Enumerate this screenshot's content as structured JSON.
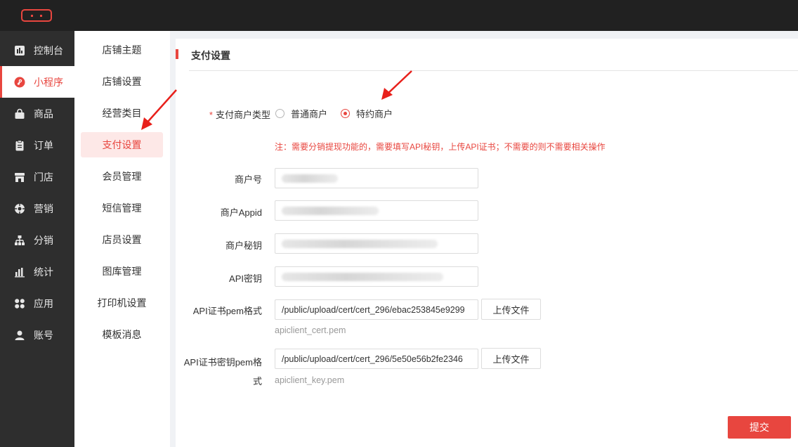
{
  "sidebar": {
    "items": [
      {
        "label": "控制台",
        "icon": "dashboard-icon"
      },
      {
        "label": "小程序",
        "icon": "mini-program-icon"
      },
      {
        "label": "商品",
        "icon": "shopping-bag-icon"
      },
      {
        "label": "订单",
        "icon": "clipboard-icon"
      },
      {
        "label": "门店",
        "icon": "store-icon"
      },
      {
        "label": "营销",
        "icon": "marketing-icon"
      },
      {
        "label": "分销",
        "icon": "hierarchy-icon"
      },
      {
        "label": "统计",
        "icon": "bar-chart-icon"
      },
      {
        "label": "应用",
        "icon": "apps-grid-icon"
      },
      {
        "label": "账号",
        "icon": "user-icon"
      }
    ],
    "active_index": 1
  },
  "subnav": {
    "items": [
      "店铺主题",
      "店铺设置",
      "经营类目",
      "支付设置",
      "会员管理",
      "短信管理",
      "店员设置",
      "图库管理",
      "打印机设置",
      "模板消息"
    ],
    "active_index": 3
  },
  "form": {
    "section_title": "支付设置",
    "merchant_type": {
      "required_mark": "*",
      "label": "支付商户类型",
      "options": [
        "普通商户",
        "特约商户"
      ],
      "selected": "特约商户"
    },
    "note": "注：需要分销提现功能的，需要填写API秘钥，上传API证书；不需要的则不需要相关操作",
    "merchant_id_label": "商户号",
    "merchant_appid_label": "商户Appid",
    "merchant_secret_label": "商户秘钥",
    "api_key_label": "API密钥",
    "cert_pem_label": "API证书pem格式",
    "cert_pem_value": "/public/upload/cert/cert_296/ebac253845e9299",
    "cert_pem_button": "上传文件",
    "cert_pem_hint": "apiclient_cert.pem",
    "key_pem_label_line1": "API证书密钥pem格",
    "key_pem_label_line2": "式",
    "key_pem_value": "/public/upload/cert/cert_296/5e50e56b2fe2346",
    "key_pem_button": "上传文件",
    "key_pem_hint": "apiclient_key.pem",
    "submit_label": "提交"
  },
  "colors": {
    "accent": "#e8463f",
    "topbar": "#212121",
    "sidebar": "#2e2e2e"
  }
}
